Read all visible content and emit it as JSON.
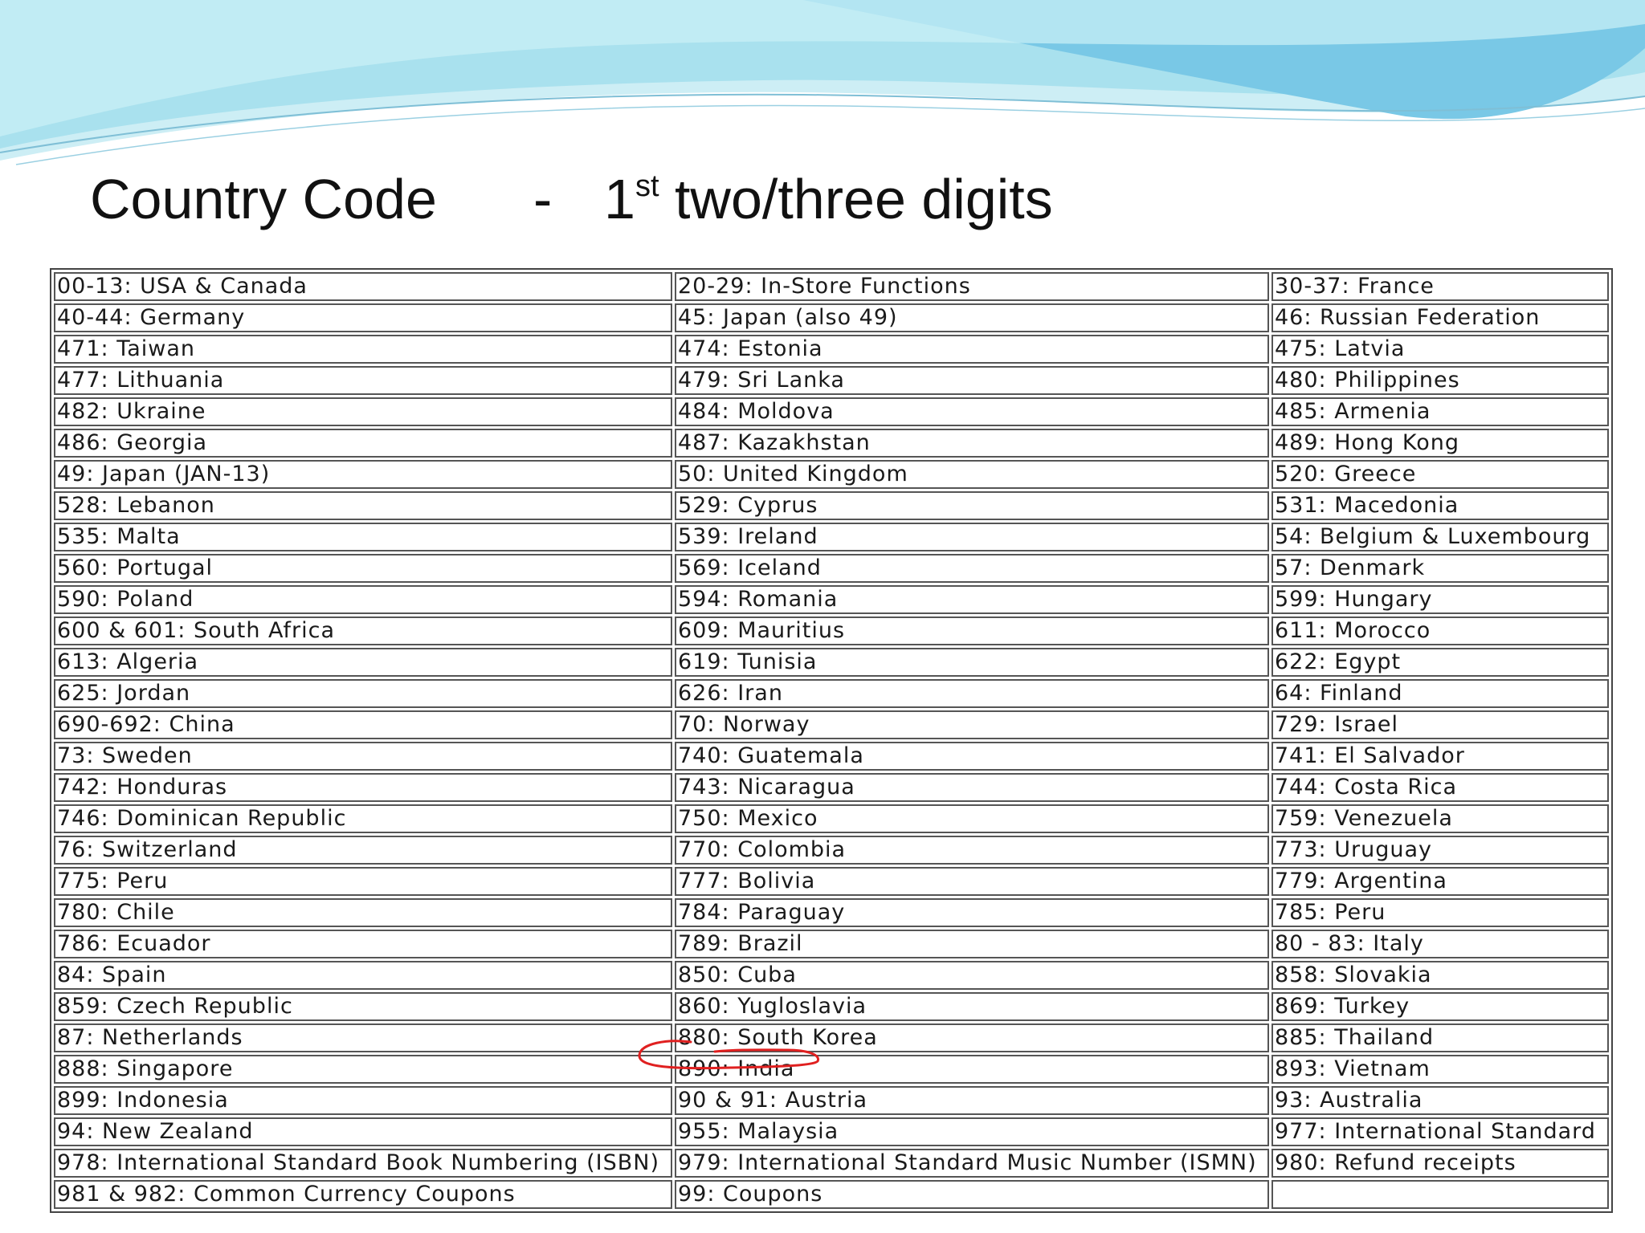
{
  "slide": {
    "title_left": "Country Code",
    "title_dash": "-",
    "title_ordinal_number": "1",
    "title_ordinal_suffix": "st",
    "title_rest": "two/three digits"
  },
  "table": {
    "rows": [
      [
        "00-13: USA & Canada",
        "20-29: In-Store Functions",
        "30-37: France"
      ],
      [
        "40-44: Germany",
        "45: Japan (also 49)",
        "46: Russian Federation"
      ],
      [
        "471: Taiwan",
        "474: Estonia",
        "475: Latvia"
      ],
      [
        "477: Lithuania",
        "479: Sri Lanka",
        "480: Philippines"
      ],
      [
        "482: Ukraine",
        "484: Moldova",
        "485: Armenia"
      ],
      [
        "486: Georgia",
        "487: Kazakhstan",
        "489: Hong Kong"
      ],
      [
        "49: Japan (JAN-13)",
        "50: United Kingdom",
        "520: Greece"
      ],
      [
        "528: Lebanon",
        "529: Cyprus",
        "531: Macedonia"
      ],
      [
        "535: Malta",
        "539: Ireland",
        "54: Belgium & Luxembourg"
      ],
      [
        "560: Portugal",
        "569: Iceland",
        "57: Denmark"
      ],
      [
        "590: Poland",
        "594: Romania",
        "599: Hungary"
      ],
      [
        "600 & 601: South Africa",
        "609: Mauritius",
        "611: Morocco"
      ],
      [
        "613: Algeria",
        "619: Tunisia",
        "622: Egypt"
      ],
      [
        "625: Jordan",
        "626: Iran",
        "64: Finland"
      ],
      [
        "690-692: China",
        "70: Norway",
        "729: Israel"
      ],
      [
        "73: Sweden",
        "740: Guatemala",
        "741: El Salvador"
      ],
      [
        "742: Honduras",
        "743: Nicaragua",
        "744: Costa Rica"
      ],
      [
        "746: Dominican Republic",
        "750: Mexico",
        "759: Venezuela"
      ],
      [
        "76: Switzerland",
        "770: Colombia",
        "773: Uruguay"
      ],
      [
        "775: Peru",
        "777: Bolivia",
        "779: Argentina"
      ],
      [
        "780: Chile",
        "784: Paraguay",
        "785: Peru"
      ],
      [
        "786: Ecuador",
        "789: Brazil",
        "80 - 83: Italy"
      ],
      [
        "84: Spain",
        "850: Cuba",
        "858: Slovakia"
      ],
      [
        "859: Czech Republic",
        "860: Yugloslavia",
        "869: Turkey"
      ],
      [
        "87: Netherlands",
        "880: South Korea",
        "885: Thailand"
      ],
      [
        "888: Singapore",
        "890: India",
        "893: Vietnam"
      ],
      [
        "899: Indonesia",
        "90 & 91: Austria",
        "93: Australia"
      ],
      [
        "94: New Zealand",
        "955: Malaysia",
        "977: International Standard"
      ],
      [
        "978: International Standard Book Numbering (ISBN)",
        "979: International Standard Music Number (ISMN)",
        "980: Refund receipts"
      ],
      [
        "981 & 982: Common Currency Coupons",
        "99: Coupons",
        ""
      ]
    ]
  },
  "annotation": {
    "highlight_color": "#e02020"
  },
  "decor": {
    "wave_light": "#bfe9f2",
    "wave_mid": "#8fd6ea",
    "wave_dark": "#6ec3e4"
  }
}
